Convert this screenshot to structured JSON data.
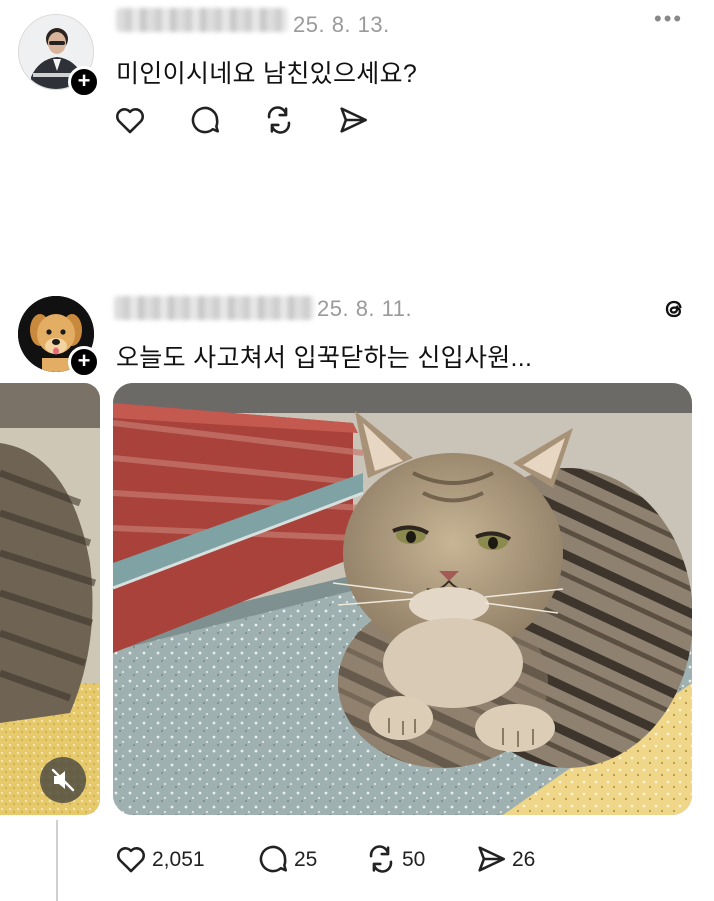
{
  "post1": {
    "date": "25. 8. 13.",
    "text": "미인이시네요 남친있으세요?",
    "more_label": "•••",
    "plus_label": "+"
  },
  "post2": {
    "date": "25. 8. 11.",
    "text": "오늘도 사고쳐서 입꾹닫하는 신입사원...",
    "plus_label": "+",
    "stats": {
      "likes": "2,051",
      "comments": "25",
      "reposts": "50",
      "shares": "26"
    }
  },
  "icons": {
    "heart": "heart-icon",
    "comment": "comment-icon",
    "repost": "repost-icon",
    "share": "share-icon",
    "threads": "threads-logo-icon",
    "mute": "mute-icon"
  }
}
